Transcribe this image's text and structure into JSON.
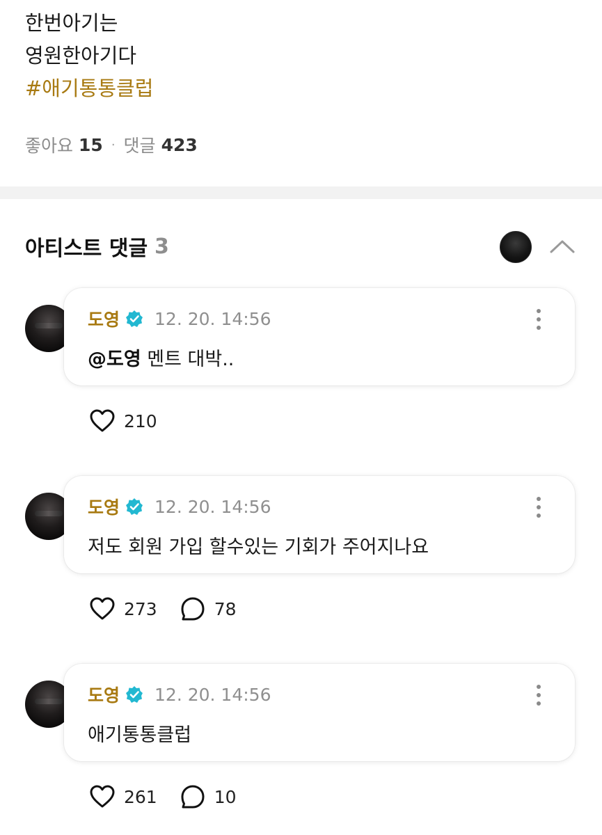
{
  "post": {
    "lines": [
      "한번아기는",
      "영원한아기다"
    ],
    "hashtag": "#애기통통클럽",
    "likes_label": "좋아요",
    "likes_count": "15",
    "separator": "·",
    "comments_label": "댓글",
    "comments_count": "423"
  },
  "artist_comments": {
    "title": "아티스트 댓글",
    "count": "3",
    "comments": [
      {
        "author": "도영",
        "time": "12. 20. 14:56",
        "mention": "@도영",
        "text": " 멘트 대박..",
        "likes": "210",
        "replies": ""
      },
      {
        "author": "도영",
        "time": "12. 20. 14:56",
        "mention": "",
        "text": "저도 회원 가입 할수있는 기회가 주어지나요",
        "likes": "273",
        "replies": "78"
      },
      {
        "author": "도영",
        "time": "12. 20. 14:56",
        "mention": "",
        "text": "애기통통클럽",
        "likes": "261",
        "replies": "10"
      }
    ]
  },
  "icons": {
    "verified": "verified-badge-icon",
    "more": "more-vertical-icon",
    "like": "heart-icon",
    "reply": "speech-bubble-icon",
    "collapse": "chevron-up-icon"
  },
  "colors": {
    "accent": "#a87a12",
    "verified": "#22b8d1",
    "muted": "#8f8f8f"
  }
}
